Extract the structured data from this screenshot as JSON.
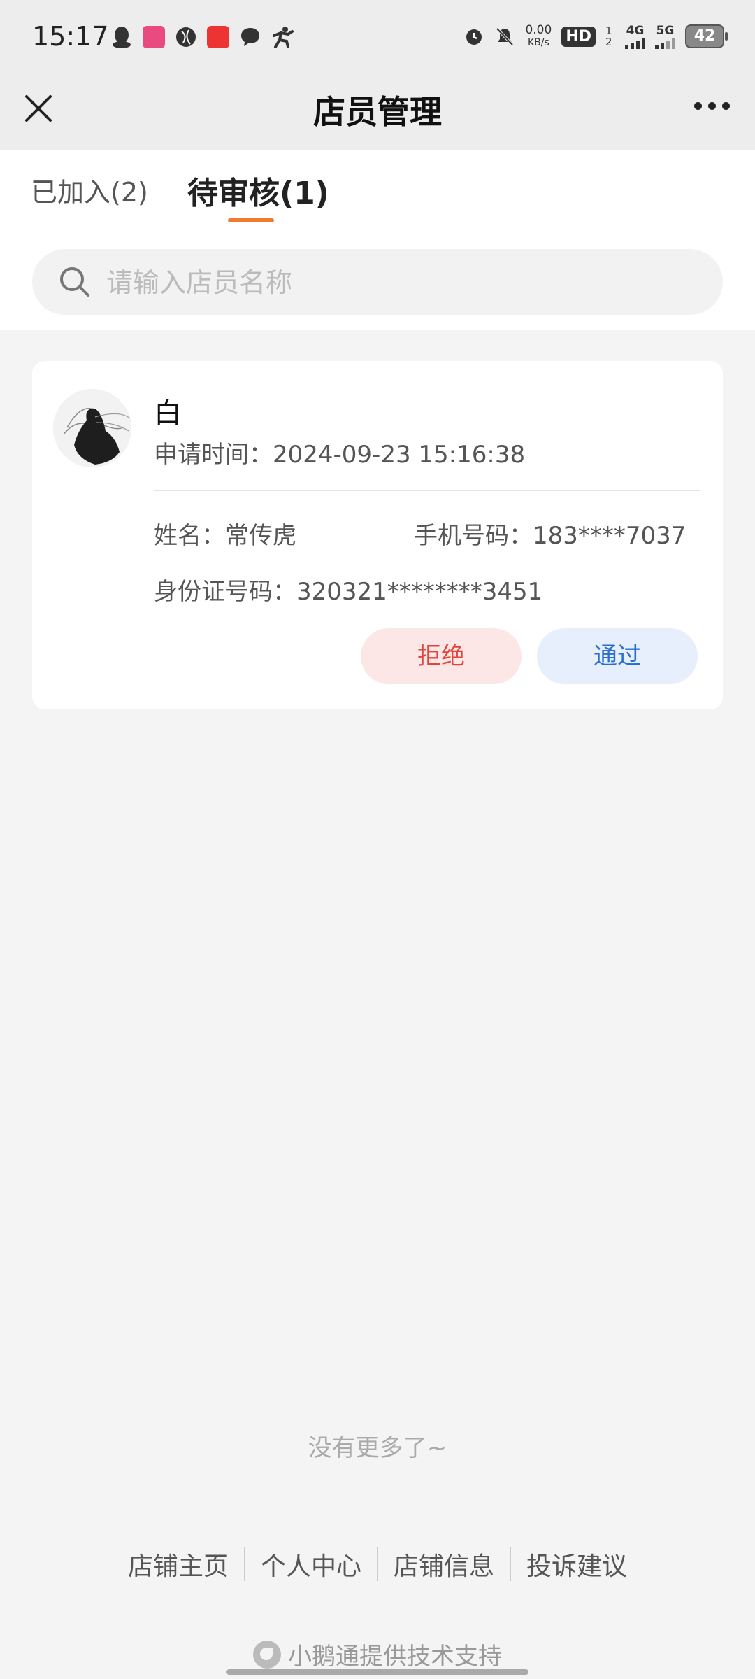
{
  "status_bar": {
    "time": "15:17",
    "net_speed_value": "0.00",
    "net_speed_unit": "KB/s",
    "hd_badge": "HD",
    "sim_indicator": "1 2",
    "net_type_1": "4G",
    "net_type_2": "5G",
    "battery": "42"
  },
  "nav": {
    "title": "店员管理"
  },
  "tabs": {
    "joined": "已加入(2)",
    "pending": "待审核(1)"
  },
  "search": {
    "placeholder": "请输入店员名称",
    "value": ""
  },
  "card": {
    "name": "白",
    "apply_time_label": "申请时间：",
    "apply_time": "2024-09-23 15:16:38",
    "real_name_label": "姓名：",
    "real_name": "常传虎",
    "phone_label": "手机号码：",
    "phone": "183****7037",
    "id_label": "身份证号码：",
    "id_number": "320321********3451",
    "reject_label": "拒绝",
    "approve_label": "通过"
  },
  "list_end_text": "没有更多了~",
  "footer": {
    "links": [
      "店铺主页",
      "个人中心",
      "店铺信息",
      "投诉建议"
    ],
    "powered_by": "小鹅通提供技术支持"
  },
  "colors": {
    "accent_tab": "#f07a2d",
    "reject_text": "#e0463c",
    "approve_text": "#2a6fd0"
  }
}
